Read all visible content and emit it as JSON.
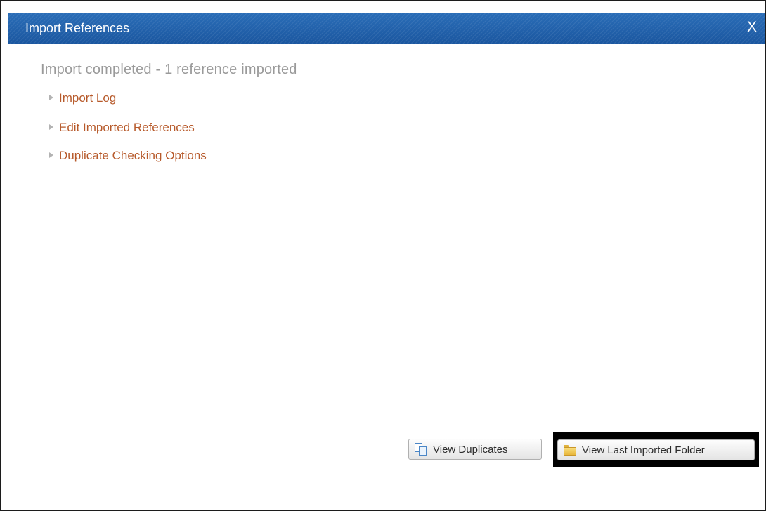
{
  "dialog": {
    "title": "Import References",
    "close_label": "X"
  },
  "status": {
    "message": "Import completed - 1 reference imported"
  },
  "options": [
    {
      "label": "Import Log"
    },
    {
      "label": "Edit Imported References"
    },
    {
      "label": "Duplicate Checking Options"
    }
  ],
  "buttons": {
    "view_duplicates": "View Duplicates",
    "view_last_imported_folder": "View Last Imported Folder"
  },
  "icons": {
    "expand": "triangle-right-icon",
    "duplicates": "copy-icon",
    "folder": "folder-icon"
  },
  "colors": {
    "titlebar": "#1f5fa7",
    "link": "#b75a2b",
    "status_text": "#9a9a9a"
  }
}
